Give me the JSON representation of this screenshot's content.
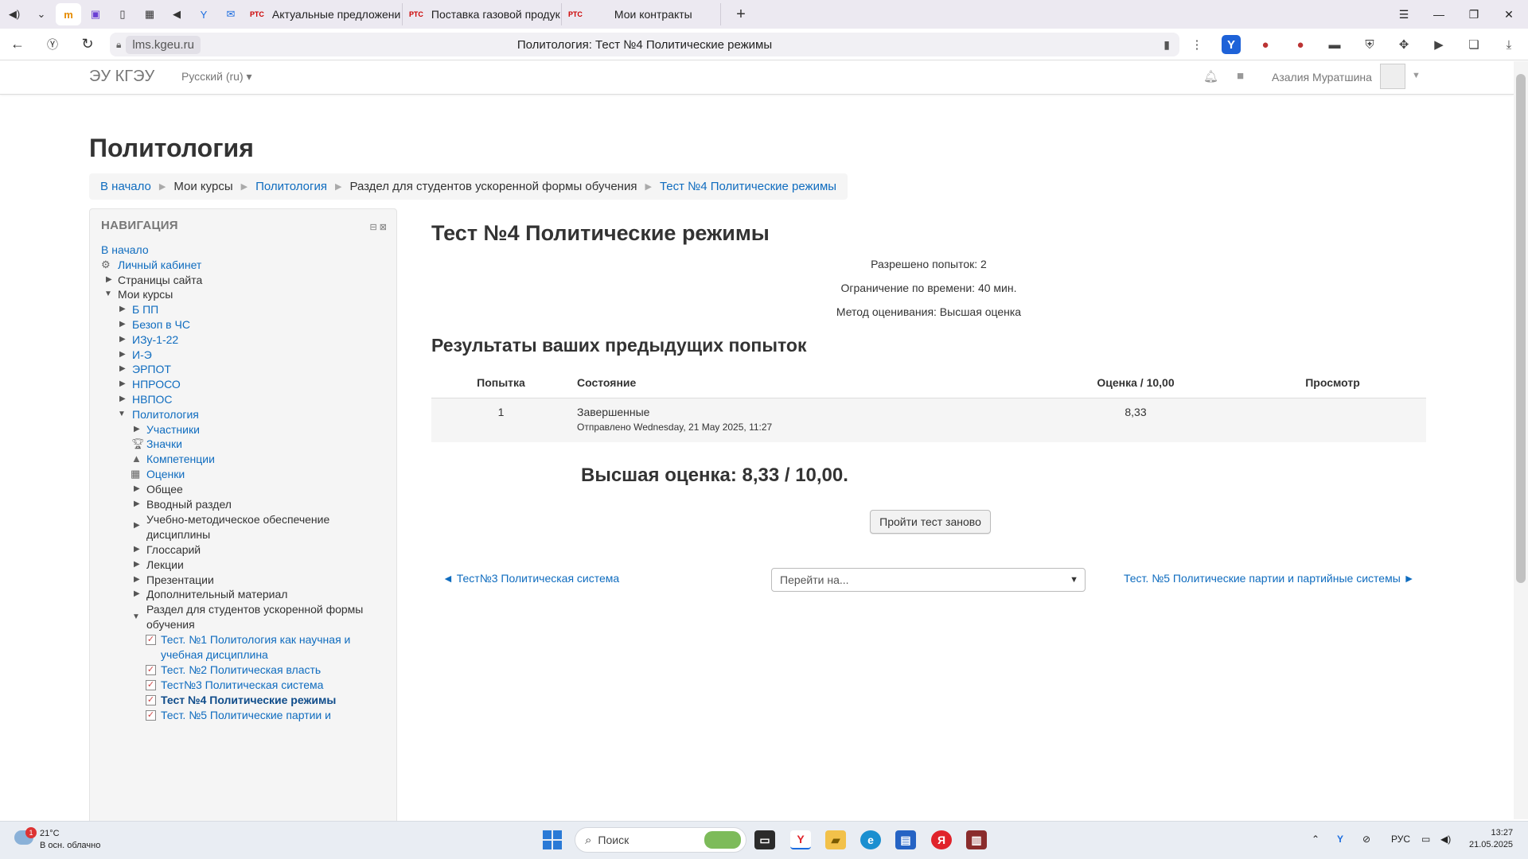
{
  "browser": {
    "tabs": [
      {
        "label": "Актуальные предложени",
        "favicon": "РТС"
      },
      {
        "label": "Поставка газовой продук",
        "favicon": "РТС"
      },
      {
        "label": "Мои контракты",
        "favicon": "РТС"
      }
    ],
    "url": "lms.kgeu.ru",
    "page_title": "Политология: Тест №4 Политические режимы"
  },
  "header": {
    "brand": "ЭУ КГЭУ",
    "language": "Русский (ru)",
    "user_name": "Азалия Муратшина"
  },
  "course_title": "Политология",
  "breadcrumb": {
    "home": "В начало",
    "my_courses": "Мои курсы",
    "course": "Политология",
    "section": "Раздел для студентов ускоренной формы обучения",
    "current": "Тест №4 Политические режимы"
  },
  "navigation": {
    "title": "НАВИГАЦИЯ",
    "home": "В начало",
    "dashboard": "Личный кабинет",
    "site_pages": "Страницы сайта",
    "my_courses": "Мои курсы",
    "courses": [
      "Б ПП",
      "Безоп в ЧС",
      "ИЗу-1-22",
      "И-Э",
      "ЭРПОТ",
      "НПРОСО",
      "НВПОС"
    ],
    "current_course": "Политология",
    "participants": "Участники",
    "badges": "Значки",
    "competencies": "Компетенции",
    "grades": "Оценки",
    "general": "Общее",
    "intro": "Вводный раздел",
    "methodical_1": "Учебно-методическое обеспечение",
    "methodical_2": "дисциплины",
    "glossary": "Глоссарий",
    "lectures": "Лекции",
    "presentations": "Презентации",
    "extra": "Дополнительный материал",
    "section_1": "Раздел для студентов ускоренной формы",
    "section_2": "обучения",
    "test1_1": "Тест. №1 Политология как научная и",
    "test1_2": "учебная дисциплина",
    "test2": "Тест. №2 Политическая власть",
    "test3": "Тест№3 Политическая система",
    "test4": "Тест №4 Политические режимы",
    "test5": "Тест. №5 Политические партии и"
  },
  "quiz": {
    "title": "Тест №4 Политические режимы",
    "attempts_allowed": "Разрешено попыток: 2",
    "time_limit": "Ограничение по времени: 40 мин.",
    "grading_method": "Метод оценивания: Высшая оценка",
    "results_title": "Результаты ваших предыдущих попыток",
    "columns": {
      "attempt": "Попытка",
      "state": "Состояние",
      "grade": "Оценка / 10,00",
      "review": "Просмотр"
    },
    "rows": [
      {
        "attempt": "1",
        "state": "Завершенные",
        "submitted": "Отправлено Wednesday, 21 May 2025, 11:27",
        "grade": "8,33"
      }
    ],
    "highest_grade": "Высшая оценка: 8,33 / 10,00.",
    "retry_button": "Пройти тест заново",
    "prev_activity": "◄ Тест№3 Политическая система",
    "jump_placeholder": "Перейти на...",
    "next_activity": "Тест. №5 Политические партии и партийные системы ►"
  },
  "taskbar": {
    "temperature": "21°C",
    "weather": "В осн. облачно",
    "weather_badge": "1",
    "search": "Поиск",
    "lang": "РУС",
    "time": "13:27",
    "date": "21.05.2025"
  }
}
